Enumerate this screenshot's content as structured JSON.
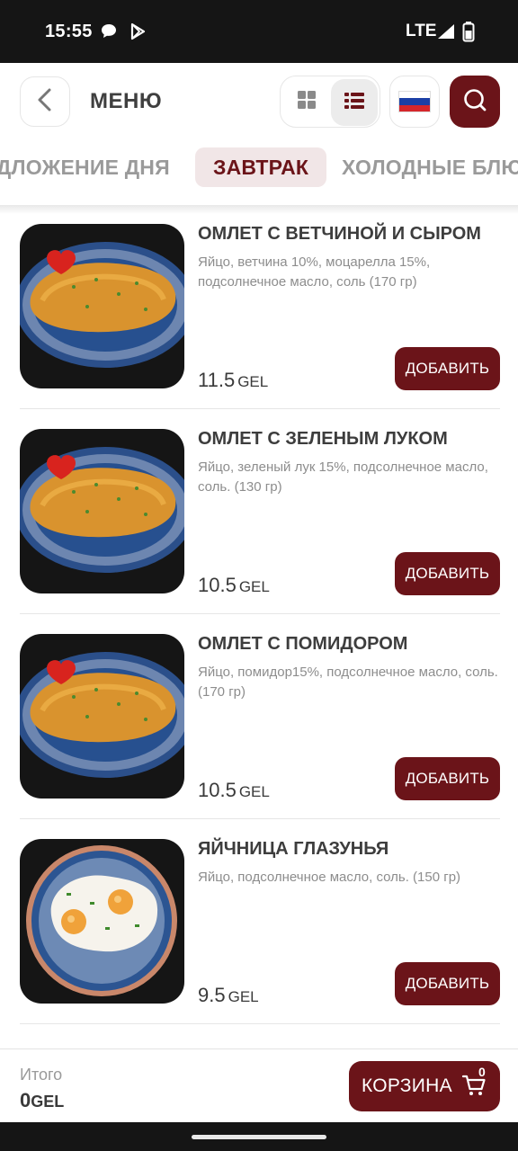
{
  "status_bar": {
    "time": "15:55",
    "network": "LTE"
  },
  "header": {
    "title": "МЕНЮ"
  },
  "tabs": [
    {
      "label": "ПРЕДЛОЖЕНИЕ ДНЯ"
    },
    {
      "label": "ЗАВТРАК"
    },
    {
      "label": "ХОЛОДНЫЕ БЛЮДА"
    }
  ],
  "active_tab": "ЗАВТРАК",
  "items": [
    {
      "name": "ОМЛЕТ С ВЕТЧИНОЙ И СЫРОМ",
      "description": "Яйцо, ветчина 10%, моцарелла 15%, подсолнечное масло, соль (170 гр)",
      "price": "11.5",
      "currency": "GEL",
      "add_label": "ДОБАВИТЬ",
      "image": "omelette"
    },
    {
      "name": "ОМЛЕТ С ЗЕЛЕНЫМ ЛУКОМ",
      "description": "Яйцо, зеленый лук 15%, подсолнечное масло, соль. (130 гр)",
      "price": "10.5",
      "currency": "GEL",
      "add_label": "ДОБАВИТЬ",
      "image": "omelette"
    },
    {
      "name": "ОМЛЕТ С ПОМИДОРОМ",
      "description": "Яйцо, помидор15%, подсолнечное масло, соль. (170 гр)",
      "price": "10.5",
      "currency": "GEL",
      "add_label": "ДОБАВИТЬ",
      "image": "omelette"
    },
    {
      "name": "ЯЙЧНИЦА ГЛАЗУНЬЯ",
      "description": "Яйцо, подсолнечное масло, соль. (150 гр)",
      "price": "9.5",
      "currency": "GEL",
      "add_label": "ДОБАВИТЬ",
      "image": "fried-eggs"
    }
  ],
  "cart": {
    "total_label": "Итого",
    "total_value": "0",
    "total_currency": "GEL",
    "button_label": "КОРЗИНА",
    "count": "0"
  },
  "colors": {
    "accent": "#6b1419",
    "tab_active_bg": "#f1e6e7",
    "flag": [
      "#ffffff",
      "#1b3fa6",
      "#d5262b"
    ]
  }
}
